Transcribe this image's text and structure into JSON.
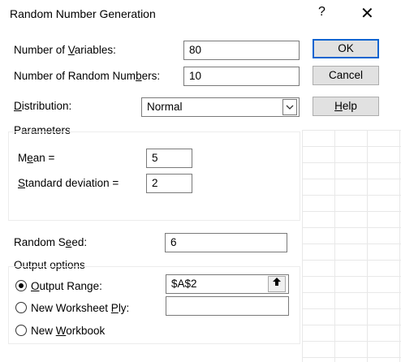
{
  "window": {
    "title": "Random Number Generation",
    "help_glyph": "?",
    "close_glyph": "✕"
  },
  "fields": {
    "num_variables": {
      "label_pre": "Number of ",
      "label_u": "V",
      "label_post": "ariables:",
      "value": "80"
    },
    "num_random": {
      "label_pre": "Number of Random Num",
      "label_u": "b",
      "label_post": "ers:",
      "value": "10"
    },
    "distribution": {
      "label_u": "D",
      "label_post": "istribution:",
      "value": "Normal"
    }
  },
  "buttons": {
    "ok": "OK",
    "cancel": "Cancel",
    "help_u": "H",
    "help_post": "elp"
  },
  "parameters": {
    "heading": "Parameters",
    "mean": {
      "label_pre": "M",
      "label_u": "e",
      "label_post": "an =",
      "value": "5"
    },
    "std": {
      "label_u": "S",
      "label_post": "tandard deviation =",
      "value": "2"
    }
  },
  "seed": {
    "label_pre": "Random S",
    "label_u": "e",
    "label_post": "ed:",
    "value": "6"
  },
  "output": {
    "heading": "Output options",
    "range": {
      "label_u": "O",
      "label_post": "utput Range:",
      "value": "$A$2",
      "checked": true
    },
    "worksheet": {
      "label_pre": "New Worksheet ",
      "label_u": "P",
      "label_post": "ly:",
      "value": "",
      "checked": false
    },
    "workbook": {
      "label_pre": "New ",
      "label_u": "W",
      "label_post": "orkbook",
      "checked": false
    }
  },
  "icons": {
    "dropdown": "chevron-down-icon",
    "collapse": "range-collapse-icon"
  }
}
